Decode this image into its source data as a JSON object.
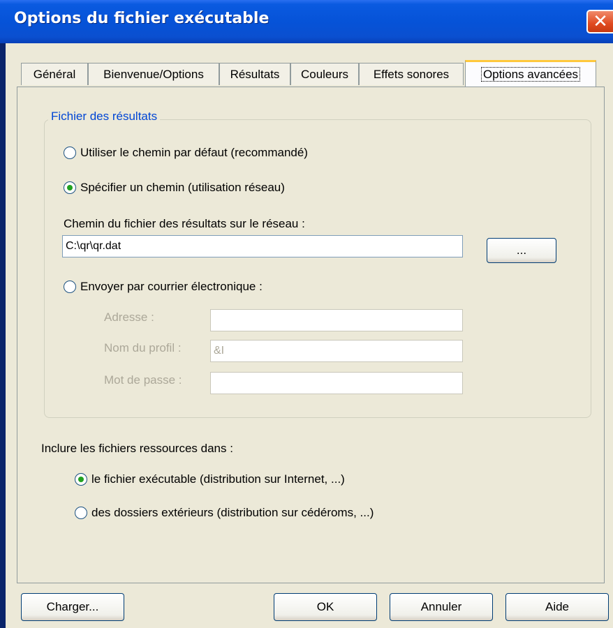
{
  "window": {
    "title": "Options du fichier exécutable",
    "close_glyph": "✕"
  },
  "tabs": [
    {
      "label": "Général",
      "active": false
    },
    {
      "label": "Bienvenue/Options",
      "active": false
    },
    {
      "label": "Résultats",
      "active": false
    },
    {
      "label": "Couleurs",
      "active": false
    },
    {
      "label": "Effets sonores",
      "active": false
    },
    {
      "label": "Options avancées",
      "active": true
    }
  ],
  "results_group": {
    "legend": "Fichier des résultats",
    "radio_default": {
      "label": "Utiliser le chemin par défaut (recommandé)",
      "checked": false
    },
    "radio_specify": {
      "label": "Spécifier un chemin (utilisation réseau)",
      "checked": true
    },
    "path_label": "Chemin du fichier des résultats sur le réseau :",
    "path_value": "C:\\qr\\qr.dat",
    "browse_label": "...",
    "radio_email": {
      "label": "Envoyer par courrier électronique :",
      "checked": false
    },
    "address_label": "Adresse :",
    "address_value": "",
    "profile_label": "Nom du profil :",
    "profile_value": "&I",
    "password_label": "Mot de passe :",
    "password_value": ""
  },
  "resources": {
    "label": "Inclure les fichiers ressources dans :",
    "radio_exe": {
      "label": "le fichier exécutable (distribution sur Internet, ...)",
      "checked": true
    },
    "radio_folders": {
      "label": "des dossiers extérieurs (distribution sur cédéroms, ...)",
      "checked": false
    }
  },
  "buttons": {
    "load": "Charger...",
    "ok": "OK",
    "cancel": "Annuler",
    "help": "Aide"
  },
  "colors": {
    "title_bar": "#0653d8",
    "dialog_bg": "#ece9d8",
    "legend_text": "#0046d5",
    "radio_check": "#21a121"
  }
}
